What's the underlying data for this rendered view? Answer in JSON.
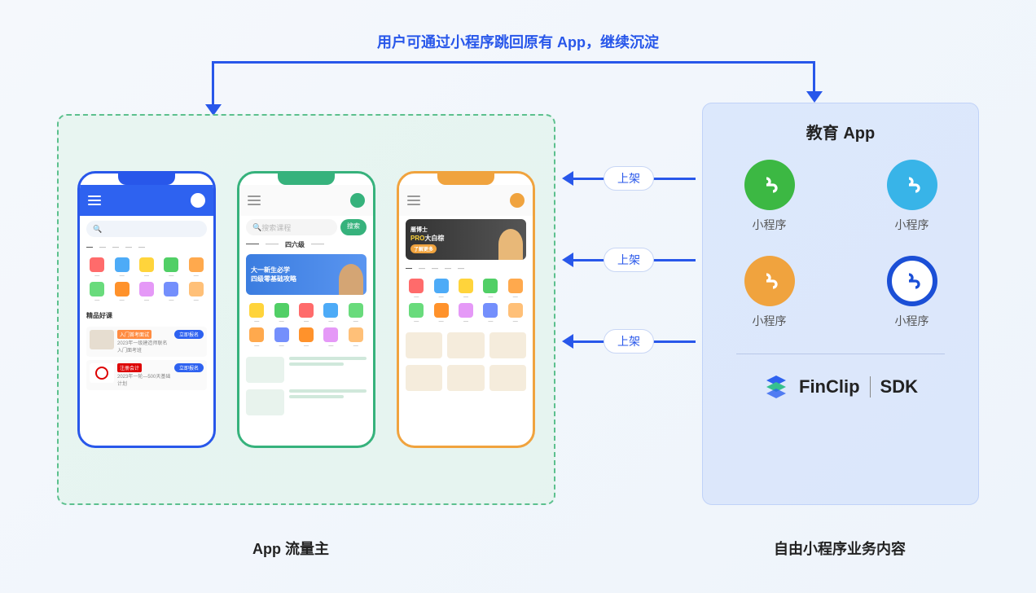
{
  "top_caption": "用户可通过小程序跳回原有 App，继续沉淀",
  "left": {
    "caption": "App 流量主",
    "phones": {
      "blue": {
        "section_title": "精品好课",
        "banner_tag": "入门首考面试",
        "card1_title": "2023年一级建造师联名入门面考班",
        "card2_tag": "注册会计",
        "card2_title": "2023年一轮—500天基础计划",
        "btn": "立即报名"
      },
      "green": {
        "search_placeholder": "搜索课程",
        "search_btn": "搜索",
        "tab": "四六级",
        "banner_line1": "大一新生必学",
        "banner_line2": "四级零基础攻略"
      },
      "orange": {
        "banner_brand": "雁博士",
        "banner_title": "PRO大白棕",
        "banner_cta": "了解更多"
      }
    }
  },
  "arrows": {
    "label": "上架"
  },
  "right": {
    "title": "教育 App",
    "mp_label": "小程序",
    "sdk_brand": "FinClip",
    "sdk_label": "SDK",
    "caption": "自由小程序业务内容"
  },
  "colors": {
    "accent": "#2857ea",
    "green": "#36b27c",
    "orange": "#f0a33e"
  }
}
